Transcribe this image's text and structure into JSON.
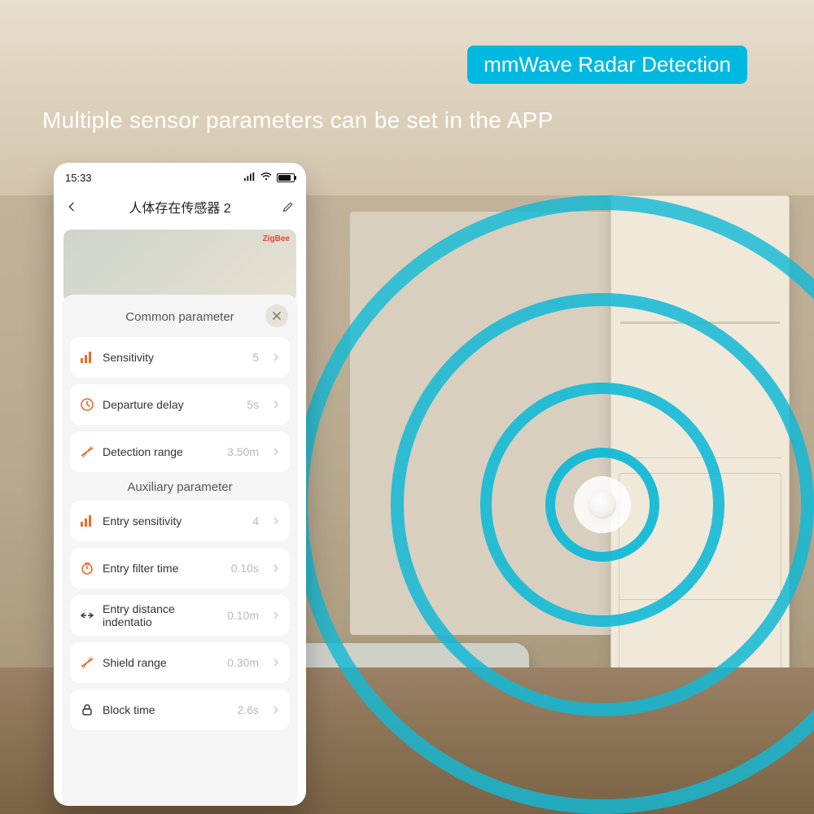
{
  "marketing": {
    "badge": "mmWave Radar Detection",
    "headline": "Multiple sensor parameters can be set in the APP"
  },
  "status": {
    "time": "15:33"
  },
  "nav": {
    "title": "人体存在传感器 2",
    "logo": "ZigBee"
  },
  "sheet": {
    "title_common": "Common parameter",
    "title_aux": "Auxiliary parameter",
    "common": [
      {
        "icon": "bars",
        "label": "Sensitivity",
        "value": "5"
      },
      {
        "icon": "clock",
        "label": "Departure delay",
        "value": "5s"
      },
      {
        "icon": "range",
        "label": "Detection range",
        "value": "3.50m"
      }
    ],
    "aux": [
      {
        "icon": "bars",
        "label": "Entry sensitivity",
        "value": "4"
      },
      {
        "icon": "timer",
        "label": "Entry filter time",
        "value": "0.10s"
      },
      {
        "icon": "dist",
        "label": "Entry distance indentatio",
        "value": "0.10m"
      },
      {
        "icon": "shield",
        "label": "Shield range",
        "value": "0.30m"
      },
      {
        "icon": "lock",
        "label": "Block time",
        "value": "2.6s"
      }
    ]
  }
}
